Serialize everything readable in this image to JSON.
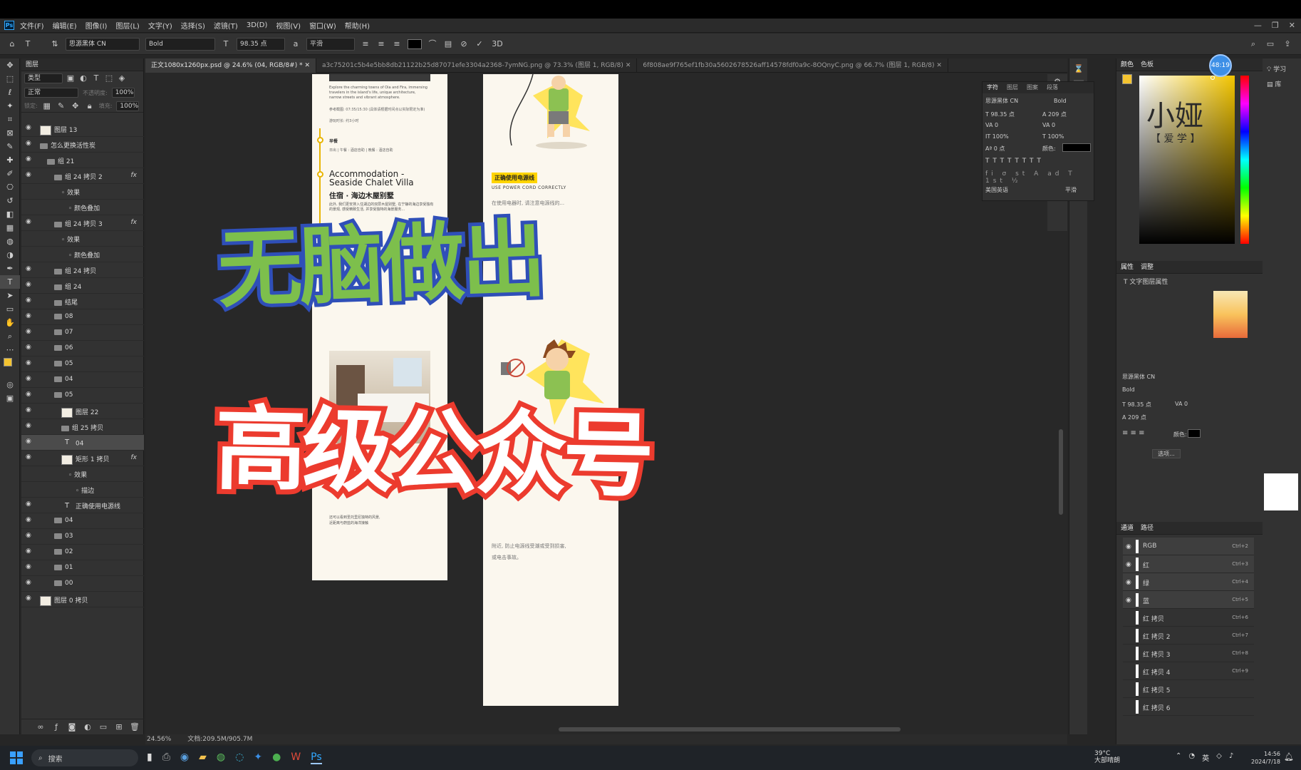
{
  "menu": {
    "items": [
      "文件(F)",
      "编辑(E)",
      "图像(I)",
      "图层(L)",
      "文字(Y)",
      "选择(S)",
      "滤镜(T)",
      "3D(D)",
      "视图(V)",
      "窗口(W)",
      "帮助(H)"
    ]
  },
  "options": {
    "font_family": "思源黑体 CN",
    "font_style": "Bold",
    "font_size": "98.35 点",
    "antialias": "平滑",
    "three_d": "3D"
  },
  "tabs": [
    "正文1080x1260px.psd @ 24.6% (04, RGB/8#) *",
    "a3c75201c5b4e5bb8db21122b25d87071efe3304a2368-7ymNG.png @ 73.3% (图层 1, RGB/8)",
    "6f808ae9f765ef1fb30a5602678526aff14578fdf0a9c-8OQnyC.png @ 66.7% (图层 1, RGB/8)"
  ],
  "layers_panel": {
    "title": "图层",
    "search": "类型",
    "blend": "正常",
    "opacity_label": "不透明度:",
    "opacity": "100%",
    "lock_label": "锁定:",
    "fill_label": "填充:",
    "fill": "100%",
    "rows": [
      {
        "name": "图层 13",
        "indent": 0,
        "type": "thumb"
      },
      {
        "name": "怎么更换活性炭",
        "indent": 0,
        "type": "group"
      },
      {
        "name": "组 21",
        "indent": 1,
        "type": "group"
      },
      {
        "name": "组 24 拷贝 2",
        "indent": 2,
        "type": "group",
        "fx": "fx"
      },
      {
        "name": "效果",
        "indent": 3,
        "type": "sub"
      },
      {
        "name": "颜色叠加",
        "indent": 4,
        "type": "sub"
      },
      {
        "name": "组 24 拷贝 3",
        "indent": 2,
        "type": "group",
        "fx": "fx"
      },
      {
        "name": "效果",
        "indent": 3,
        "type": "sub"
      },
      {
        "name": "颜色叠加",
        "indent": 4,
        "type": "sub"
      },
      {
        "name": "组 24 拷贝",
        "indent": 2,
        "type": "group"
      },
      {
        "name": "组 24",
        "indent": 2,
        "type": "group"
      },
      {
        "name": "结尾",
        "indent": 2,
        "type": "group"
      },
      {
        "name": "08",
        "indent": 2,
        "type": "group"
      },
      {
        "name": "07",
        "indent": 2,
        "type": "group"
      },
      {
        "name": "06",
        "indent": 2,
        "type": "group"
      },
      {
        "name": "05",
        "indent": 2,
        "type": "group"
      },
      {
        "name": "04",
        "indent": 2,
        "type": "group"
      },
      {
        "name": "05",
        "indent": 2,
        "type": "group"
      },
      {
        "name": "图层 22",
        "indent": 3,
        "type": "thumb"
      },
      {
        "name": "组 25 拷贝",
        "indent": 3,
        "type": "group"
      },
      {
        "name": "04",
        "indent": 3,
        "type": "text",
        "selected": true
      },
      {
        "name": "矩形 1 拷贝",
        "indent": 3,
        "type": "thumb",
        "fx": "fx"
      },
      {
        "name": "效果",
        "indent": 4,
        "type": "sub"
      },
      {
        "name": "描边",
        "indent": 5,
        "type": "sub"
      },
      {
        "name": "正确使用电源线",
        "indent": 3,
        "type": "text"
      },
      {
        "name": "04",
        "indent": 2,
        "type": "group"
      },
      {
        "name": "03",
        "indent": 2,
        "type": "group"
      },
      {
        "name": "02",
        "indent": 2,
        "type": "group"
      },
      {
        "name": "01",
        "indent": 2,
        "type": "group"
      },
      {
        "name": "00",
        "indent": 2,
        "type": "group"
      },
      {
        "name": "图层 0 拷贝",
        "indent": 0,
        "type": "thumb"
      }
    ]
  },
  "doc1": {
    "intro": "Explore the charming towns of Oia and Fira, immersing travelers in the island's life, unique architecture, narrow streets and vibrant atmosphere.",
    "ref": "参考截图: 07:35/15:30 (具体请根据时间点以实际限定为准)",
    "duration": "游玩时长: 约3小时",
    "section": "早餐",
    "meal": "日出 | 午餐 : 酒店自助 | 晚餐 : 酒店自助",
    "title_en": "Accommodation - Seaside Chalet Villa",
    "title_cn": "住宿 · 海边木屋别墅",
    "desc": "此外, 我们更安排入住湖边的双层木屋别墅, 在宁静的海边享受独有的景观, 感受精致生活, 并享受独特的海景服务...",
    "footer": "还可以看到圣托里尼独特的风景,\n近距离与蔚蓝的海洋接触"
  },
  "doc2": {
    "tag": "正确使用电源线",
    "tag_en": "USE POWER CORD CORRECTLY",
    "body_top": "在使用电器时, 请注意电源线的...",
    "body_bottom": "附近, 防止电源线受潮或受到损害,\n或电击事故。"
  },
  "overlay": {
    "line1": "无脑做出",
    "line2": "高级公众号"
  },
  "status": {
    "zoom": "24.56%",
    "doc": "文档:209.5M/905.7M"
  },
  "char_panel": {
    "tabs": [
      "字符",
      "图层",
      "图案",
      "段落"
    ],
    "font": "思源黑体 CN",
    "style": "Bold",
    "size": "98.35 点",
    "leading": "209 点",
    "kerning": "0",
    "tracking": "0",
    "vscale": "100%",
    "hscale": "100%",
    "baseline": "0 点",
    "color_label": "颜色:",
    "lang": "美国英语",
    "aa": "平滑"
  },
  "color_panel": {
    "tabs": [
      "颜色",
      "色板"
    ],
    "timer": "48:19",
    "watermark": "小娅",
    "watermark_sub": "【 爱 学 】"
  },
  "props_panel": {
    "tabs": [
      "属性",
      "调整"
    ],
    "heading": "文字图层属性",
    "font": "思源黑体 CN",
    "style": "Bold",
    "size": "98.35 点",
    "tracking": "0",
    "leading": "209 点",
    "color_label": "颜色:",
    "more": "选项..."
  },
  "channels_panel": {
    "tabs": [
      "通道",
      "路径"
    ],
    "rows": [
      {
        "name": "RGB",
        "key": "Ctrl+2",
        "visible": true
      },
      {
        "name": "红",
        "key": "Ctrl+3",
        "visible": true
      },
      {
        "name": "绿",
        "key": "Ctrl+4",
        "visible": true
      },
      {
        "name": "蓝",
        "key": "Ctrl+5",
        "visible": true
      },
      {
        "name": "红 拷贝",
        "key": "Ctrl+6",
        "visible": false
      },
      {
        "name": "红 拷贝 2",
        "key": "Ctrl+7",
        "visible": false
      },
      {
        "name": "红 拷贝 3",
        "key": "Ctrl+8",
        "visible": false
      },
      {
        "name": "红 拷贝 4",
        "key": "Ctrl+9",
        "visible": false
      },
      {
        "name": "红 拷贝 5",
        "key": "",
        "visible": false
      },
      {
        "name": "红 拷贝 6",
        "key": "",
        "visible": false
      }
    ]
  },
  "far_right": {
    "learn": "学习",
    "libraries": "库"
  },
  "taskbar": {
    "search": "搜索",
    "weather_temp": "39°C",
    "weather_desc": "大部晴朗",
    "ime": "英",
    "time": "14:56",
    "date": "2024/7/18"
  },
  "colors": {
    "overlay_green": "#7dbf4c",
    "overlay_blue": "#2f4fb8",
    "overlay_red": "#ec3b2e",
    "ps_blue": "#31a8ff"
  }
}
